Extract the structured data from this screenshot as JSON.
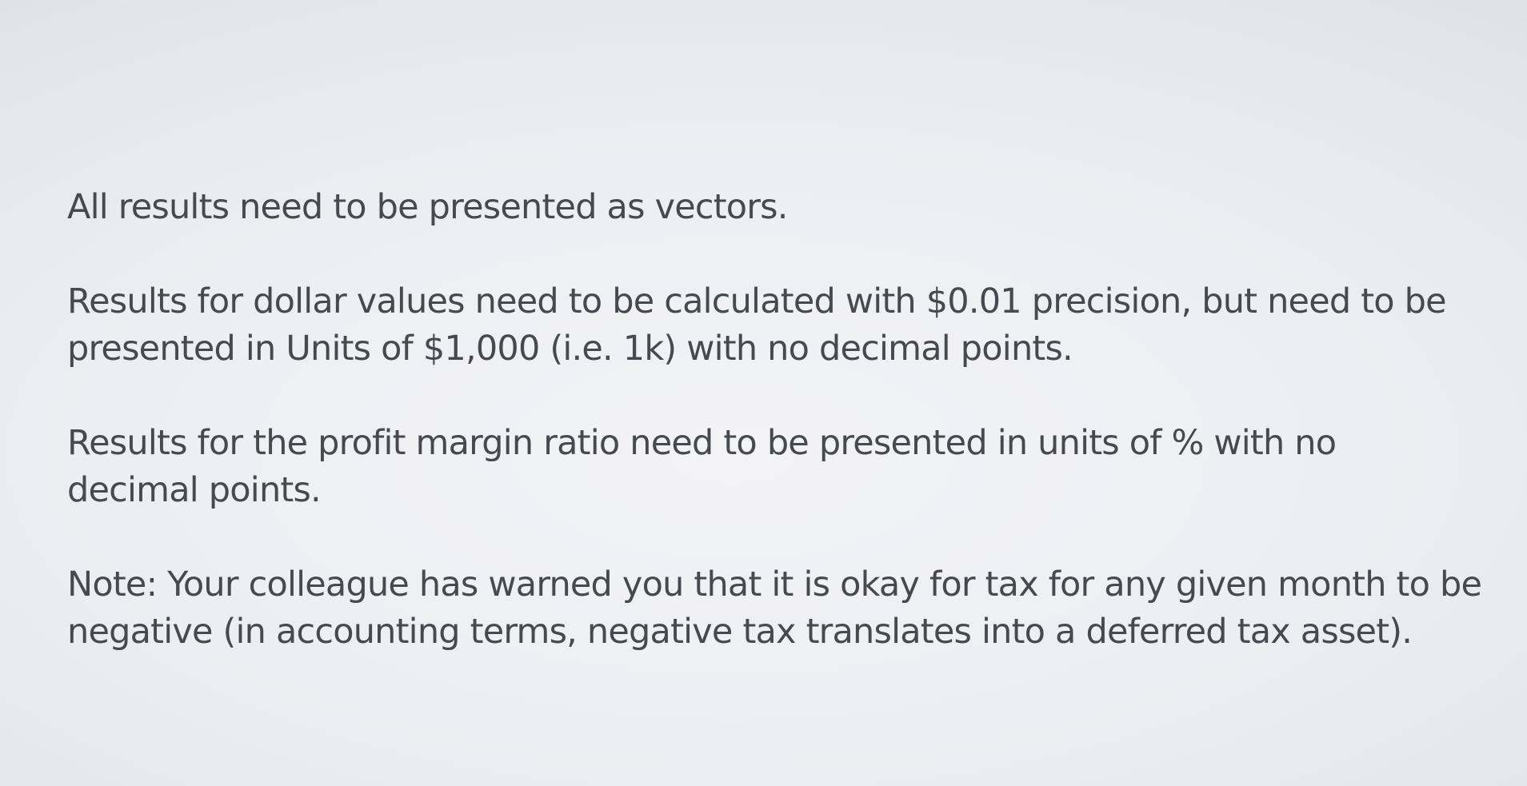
{
  "slide": {
    "paragraphs": [
      "All results need to be presented as vectors.",
      "Results for dollar values need to be calculated with $0.01 precision, but need to be presented in Units of $1,000 (i.e. 1k) with no decimal points.",
      "Results for the profit margin ratio need to be presented in units of % with no decimal points.",
      "Note: Your colleague has warned you that it is okay for tax for any given month to be negative (in accounting terms, negative tax translates into a deferred tax asset)."
    ]
  },
  "colors": {
    "text": "#474950",
    "background_center": "#f3f3f7",
    "background_edge": "#d7dbe0"
  }
}
